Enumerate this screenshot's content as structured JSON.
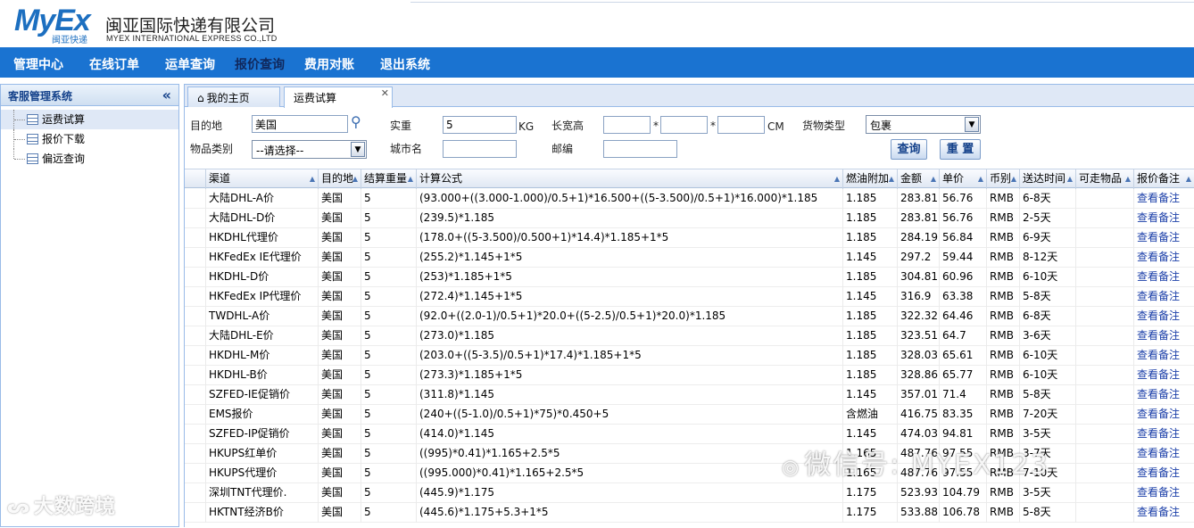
{
  "header": {
    "logo_text": "MyEx",
    "logo_sub": "闽亚快递",
    "company_cn": "闽亚国际快递有限公司",
    "company_en": "MYEX INTERNATIONAL EXPRESS CO.,LTD"
  },
  "nav": {
    "items": [
      "管理中心",
      "在线订单",
      "运单查询",
      "报价查询",
      "费用对账",
      "退出系统"
    ],
    "active": "报价查询"
  },
  "sidebar": {
    "title": "客服管理系统",
    "collapse_glyph": "«",
    "items": [
      "运费试算",
      "报价下载",
      "偏远查询"
    ],
    "selected": "运费试算"
  },
  "tabs": {
    "items": [
      "我的主页",
      "运费试算"
    ],
    "active": "运费试算"
  },
  "form": {
    "dest_label": "目的地",
    "dest_value": "美国",
    "weight_label": "实重",
    "weight_value": "5",
    "weight_unit": "KG",
    "dims_label": "长宽高",
    "dims_sep": "*",
    "dims_unit": "CM",
    "goods_type_label": "货物类型",
    "goods_type_value": "包裹",
    "category_label": "物品类别",
    "category_value": "--请选择--",
    "city_label": "城市名",
    "postcode_label": "邮编",
    "query_button": "查询",
    "reset_button": "重 置"
  },
  "table": {
    "columns": [
      "渠道",
      "目的地",
      "结算重量",
      "计算公式",
      "燃油附加",
      "金额",
      "单价",
      "币别",
      "送达时间",
      "可走物品",
      "报价备注"
    ],
    "rows": [
      [
        "大陆DHL-A价",
        "美国",
        "5",
        "(93.000+((3.000-1.000)/0.5+1)*16.500+((5-3.500)/0.5+1)*16.000)*1.185",
        "1.185",
        "283.81",
        "56.76",
        "RMB",
        "6-8天",
        "",
        "查看备注"
      ],
      [
        "大陆DHL-D价",
        "美国",
        "5",
        "(239.5)*1.185",
        "1.185",
        "283.81",
        "56.76",
        "RMB",
        "2-5天",
        "",
        "查看备注"
      ],
      [
        "HKDHL代理价",
        "美国",
        "5",
        "(178.0+((5-3.500)/0.500+1)*14.4)*1.185+1*5",
        "1.185",
        "284.19",
        "56.84",
        "RMB",
        "6-9天",
        "",
        "查看备注"
      ],
      [
        "HKFedEx IE代理价",
        "美国",
        "5",
        "(255.2)*1.145+1*5",
        "1.145",
        "297.2",
        "59.44",
        "RMB",
        "8-12天",
        "",
        "查看备注"
      ],
      [
        "HKDHL-D价",
        "美国",
        "5",
        "(253)*1.185+1*5",
        "1.185",
        "304.81",
        "60.96",
        "RMB",
        "6-10天",
        "",
        "查看备注"
      ],
      [
        "HKFedEx IP代理价",
        "美国",
        "5",
        "(272.4)*1.145+1*5",
        "1.145",
        "316.9",
        "63.38",
        "RMB",
        "5-8天",
        "",
        "查看备注"
      ],
      [
        "TWDHL-A价",
        "美国",
        "5",
        "(92.0+((2.0-1)/0.5+1)*20.0+((5-2.5)/0.5+1)*20.0)*1.185",
        "1.185",
        "322.32",
        "64.46",
        "RMB",
        "6-8天",
        "",
        "查看备注"
      ],
      [
        "大陆DHL-E价",
        "美国",
        "5",
        "(273.0)*1.185",
        "1.185",
        "323.51",
        "64.7",
        "RMB",
        "3-6天",
        "",
        "查看备注"
      ],
      [
        "HKDHL-M价",
        "美国",
        "5",
        "(203.0+((5-3.5)/0.5+1)*17.4)*1.185+1*5",
        "1.185",
        "328.03",
        "65.61",
        "RMB",
        "6-10天",
        "",
        "查看备注"
      ],
      [
        "HKDHL-B价",
        "美国",
        "5",
        "(273.3)*1.185+1*5",
        "1.185",
        "328.86",
        "65.77",
        "RMB",
        "6-10天",
        "",
        "查看备注"
      ],
      [
        "SZFED-IE促销价",
        "美国",
        "5",
        "(311.8)*1.145",
        "1.145",
        "357.01",
        "71.4",
        "RMB",
        "5-8天",
        "",
        "查看备注"
      ],
      [
        "EMS报价",
        "美国",
        "5",
        "(240+((5-1.0)/0.5+1)*75)*0.450+5",
        "含燃油",
        "416.75",
        "83.35",
        "RMB",
        "7-20天",
        "",
        "查看备注"
      ],
      [
        "SZFED-IP促销价",
        "美国",
        "5",
        "(414.0)*1.145",
        "1.145",
        "474.03",
        "94.81",
        "RMB",
        "3-5天",
        "",
        "查看备注"
      ],
      [
        "HKUPS红单价",
        "美国",
        "5",
        "((995)*0.41)*1.165+2.5*5",
        "1.165",
        "487.76",
        "97.55",
        "RMB",
        "3-7天",
        "",
        "查看备注"
      ],
      [
        "HKUPS代理价",
        "美国",
        "5",
        "((995.000)*0.41)*1.165+2.5*5",
        "1.165",
        "487.76",
        "97.55",
        "RMB",
        "7-10天",
        "",
        "查看备注"
      ],
      [
        "深圳TNT代理价.",
        "美国",
        "5",
        "(445.9)*1.175",
        "1.175",
        "523.93",
        "104.79",
        "RMB",
        "3-5天",
        "",
        "查看备注"
      ],
      [
        "HKTNT经济B价",
        "美国",
        "5",
        "(445.6)*1.175+5.3+1*5",
        "1.175",
        "533.88",
        "106.78",
        "RMB",
        "5-8天",
        "",
        "查看备注"
      ]
    ]
  },
  "watermarks": {
    "left": "大数跨境",
    "right": "微信号: MYEX123"
  },
  "colors": {
    "nav_bg": "#1a73d1",
    "brand": "#1c6fc0",
    "link": "#1a3ea8"
  }
}
